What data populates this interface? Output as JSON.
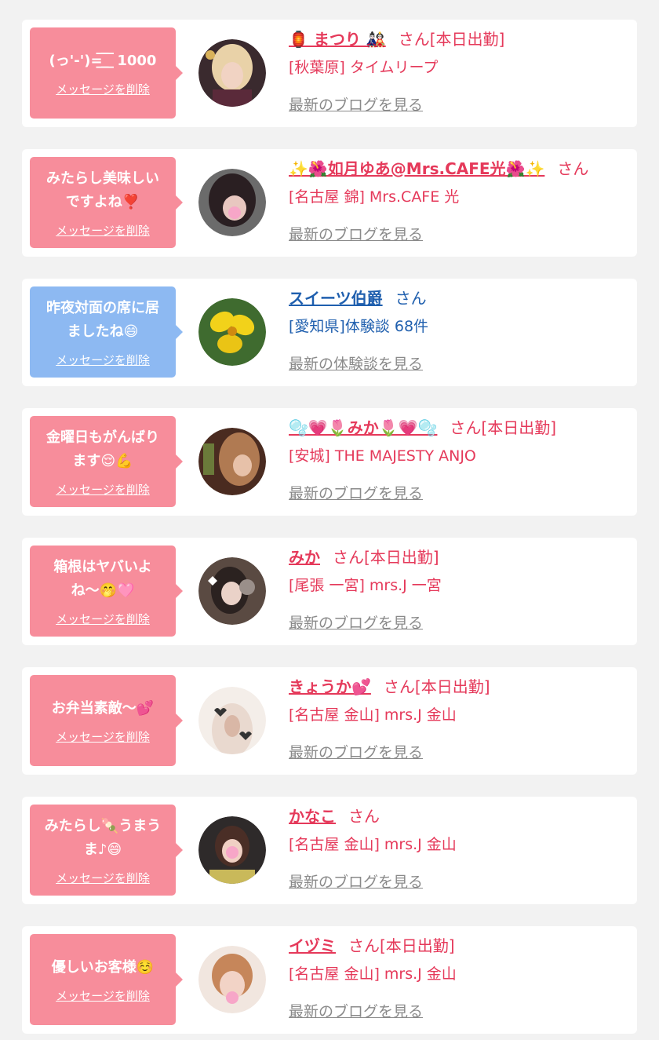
{
  "colors": {
    "card_bg": "#ffffff",
    "page_bg": "#f2f2f2",
    "pink_bubble": "#f78d9b",
    "blue_bubble": "#8db9f2",
    "pink_text": "#e5395a",
    "blue_text": "#1f5fae",
    "blog_link": "#8a8a8a"
  },
  "items": [
    {
      "message": "(っ'-')=͟͟͞͞ ͟͟͞͞ ︎ 1000",
      "delete_label": "メッセージを削除",
      "name": "🏮 まつり 🎎",
      "san": "さん[本日出勤]",
      "shop": "[秋葉原] タイムリープ",
      "blog_label": "最新のブログを見る",
      "theme": "pink"
    },
    {
      "message": "みたらし美味しい\nですよね❣️",
      "delete_label": "メッセージを削除",
      "name": "✨🌺如月ゆあ@Mrs.CAFE光🌺✨",
      "san": "さん",
      "shop": "[名古屋 錦] Mrs.CAFE 光",
      "blog_label": "最新のブログを見る",
      "theme": "pink"
    },
    {
      "message": "昨夜対面の席に居\nましたね😄",
      "delete_label": "メッセージを削除",
      "name": "スイーツ伯爵",
      "san": "さん",
      "shop": "[愛知県]体験談 68件",
      "blog_label": "最新の体験談を見る",
      "theme": "blue"
    },
    {
      "message": "金曜日もがんばり\nます😌💪",
      "delete_label": "メッセージを削除",
      "name": "🫧💗🌷みか🌷💗🫧",
      "san": "さん[本日出勤]",
      "shop": "[安城] THE MAJESTY ANJO",
      "blog_label": "最新のブログを見る",
      "theme": "pink"
    },
    {
      "message": "箱根はヤバいよ\nね〜🤭🩷",
      "delete_label": "メッセージを削除",
      "name": "みか",
      "san": "さん[本日出勤]",
      "shop": "[尾張 一宮] mrs.J 一宮",
      "blog_label": "最新のブログを見る",
      "theme": "pink"
    },
    {
      "message": "お弁当素敵〜💕",
      "delete_label": "メッセージを削除",
      "name": "きょうか💕",
      "san": "さん[本日出勤]",
      "shop": "[名古屋 金山] mrs.J 金山",
      "blog_label": "最新のブログを見る",
      "theme": "pink"
    },
    {
      "message": "みたらし🍡うまう\nま♪😄",
      "delete_label": "メッセージを削除",
      "name": "かなこ",
      "san": "さん",
      "shop": "[名古屋 金山] mrs.J 金山",
      "blog_label": "最新のブログを見る",
      "theme": "pink"
    },
    {
      "message": "優しいお客様☺️",
      "delete_label": "メッセージを削除",
      "name": "イヅミ",
      "san": "さん[本日出勤]",
      "shop": "[名古屋 金山] mrs.J 金山",
      "blog_label": "最新のブログを見る",
      "theme": "pink"
    }
  ]
}
